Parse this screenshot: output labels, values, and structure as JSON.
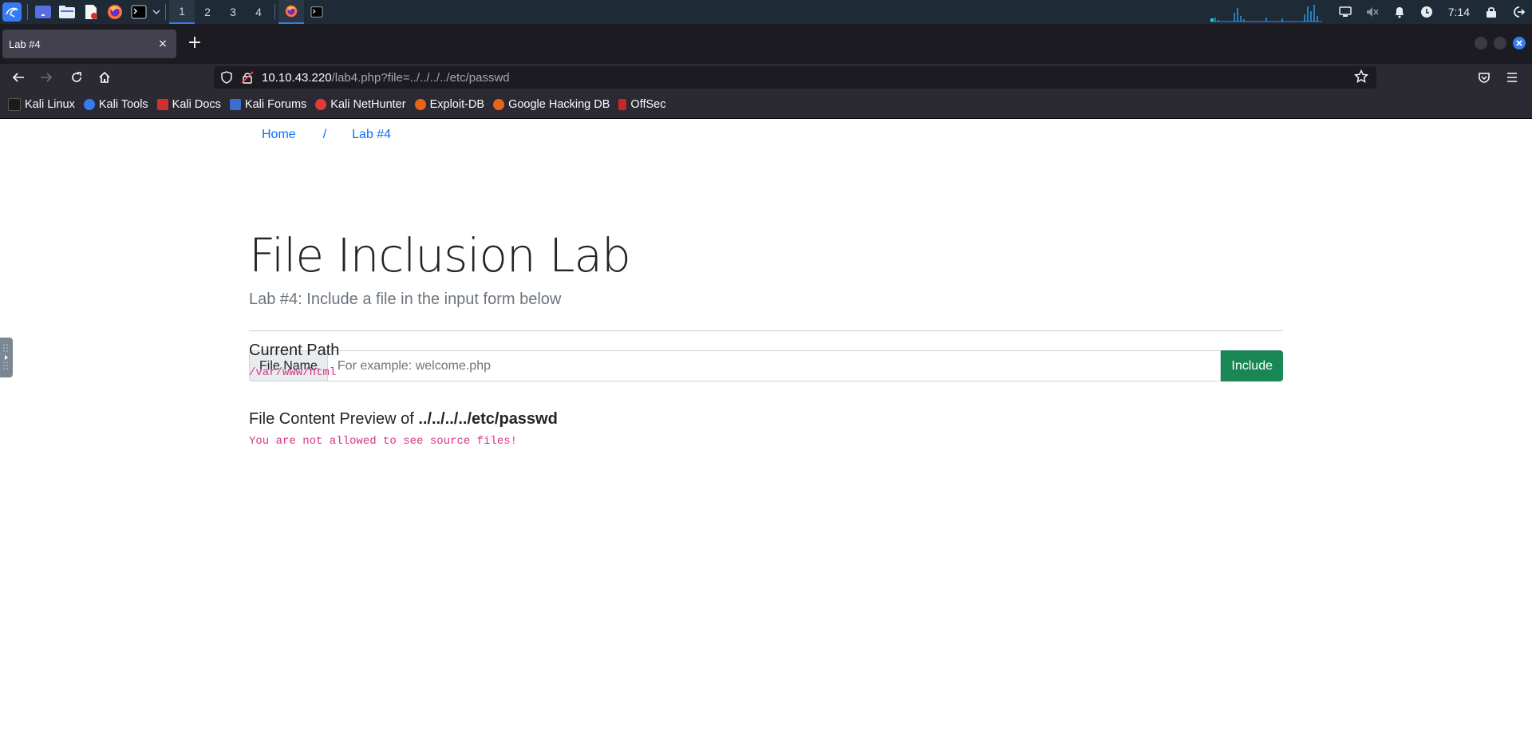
{
  "taskbar": {
    "workspaces": [
      "1",
      "2",
      "3",
      "4"
    ],
    "active_workspace": "1",
    "clock": "7:14",
    "accent_color": "#367bf0"
  },
  "browser": {
    "tab": {
      "title": "Lab #4",
      "close_glyph": "×"
    },
    "new_tab_glyph": "+",
    "url": {
      "host": "10.10.43.220",
      "path": "/lab4.php?file=../../../../etc/passwd"
    },
    "bookmarks": [
      {
        "label": "Kali Linux",
        "color": "#1b1b1b"
      },
      {
        "label": "Kali Tools",
        "color": "#367bf0"
      },
      {
        "label": "Kali Docs",
        "color": "#d32f2f"
      },
      {
        "label": "Kali Forums",
        "color": "#3b6fcf"
      },
      {
        "label": "Kali NetHunter",
        "color": "#e53935"
      },
      {
        "label": "Exploit-DB",
        "color": "#e8641b"
      },
      {
        "label": "Google Hacking DB",
        "color": "#e8641b"
      },
      {
        "label": "OffSec",
        "color": "#c62828"
      }
    ]
  },
  "page": {
    "breadcrumb": {
      "home": "Home",
      "separator": "/",
      "current": "Lab #4"
    },
    "title": "File Inclusion Lab",
    "subtitle": "Lab #4: Include a file in the input form below",
    "form": {
      "label": "File Name",
      "placeholder": "For example: welcome.php",
      "value": "",
      "button": "Include",
      "button_color": "#198754"
    },
    "current_path": {
      "heading": "Current Path",
      "value": "/var/www/html"
    },
    "preview": {
      "heading_prefix": "File Content Preview of ",
      "filename": "../../../../etc/passwd",
      "message": "You are not allowed to see source files!"
    },
    "link_color": "#0d6efd",
    "code_color": "#d63384"
  }
}
